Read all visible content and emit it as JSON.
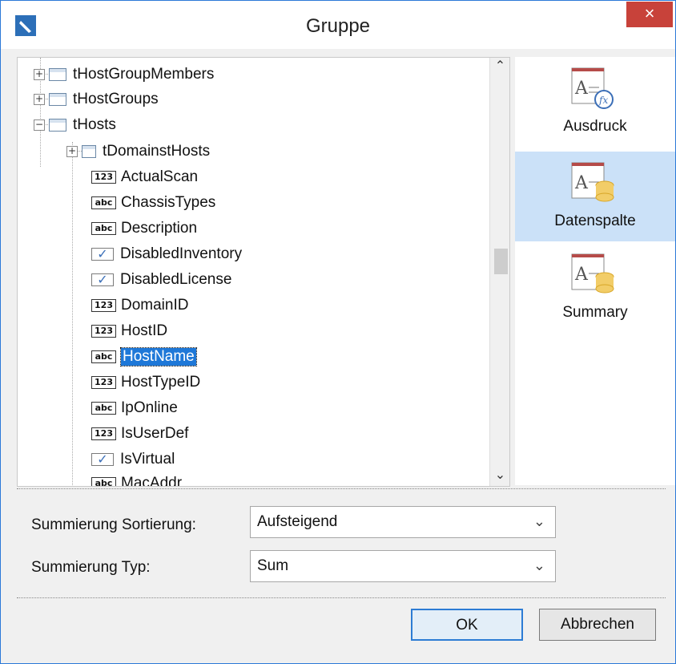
{
  "dialog": {
    "title": "Gruppe",
    "close_label": "×"
  },
  "tree": {
    "items": [
      {
        "label": "tHostGroupMembers",
        "kind": "table",
        "expander": "+"
      },
      {
        "label": "tHostGroups",
        "kind": "table",
        "expander": "+"
      },
      {
        "label": "tHosts",
        "kind": "table",
        "expander": "−"
      },
      {
        "label": "tDomainstHosts",
        "kind": "relation",
        "expander": "+"
      },
      {
        "label": "ActualScan",
        "kind": "field",
        "type_badge": "123"
      },
      {
        "label": "ChassisTypes",
        "kind": "field",
        "type_badge": "abc"
      },
      {
        "label": "Description",
        "kind": "field",
        "type_badge": "abc"
      },
      {
        "label": "DisabledInventory",
        "kind": "field",
        "type_badge": "✓"
      },
      {
        "label": "DisabledLicense",
        "kind": "field",
        "type_badge": "✓"
      },
      {
        "label": "DomainID",
        "kind": "field",
        "type_badge": "123"
      },
      {
        "label": "HostID",
        "kind": "field",
        "type_badge": "123"
      },
      {
        "label": "HostName",
        "kind": "field",
        "type_badge": "abc",
        "selected": true
      },
      {
        "label": "HostTypeID",
        "kind": "field",
        "type_badge": "123"
      },
      {
        "label": "IpOnline",
        "kind": "field",
        "type_badge": "abc"
      },
      {
        "label": "IsUserDef",
        "kind": "field",
        "type_badge": "123"
      },
      {
        "label": "IsVirtual",
        "kind": "field",
        "type_badge": "✓"
      },
      {
        "label": "MacAddr",
        "kind": "field",
        "type_badge": "abc"
      }
    ]
  },
  "expression_types": [
    {
      "label": "Ausdruck",
      "icon": "expression-icon"
    },
    {
      "label": "Datenspalte",
      "icon": "data-column-icon",
      "selected": true
    },
    {
      "label": "Summary",
      "icon": "summary-icon"
    }
  ],
  "form": {
    "sort_label": "Summierung Sortierung:",
    "sort_value": "Aufsteigend",
    "type_label": "Summierung Typ:",
    "type_value": "Sum"
  },
  "buttons": {
    "ok": "OK",
    "cancel": "Abbrechen"
  },
  "colors": {
    "selection": "#1e78d8",
    "selected_panel": "#cbe1f8",
    "close_button": "#c8423a"
  }
}
